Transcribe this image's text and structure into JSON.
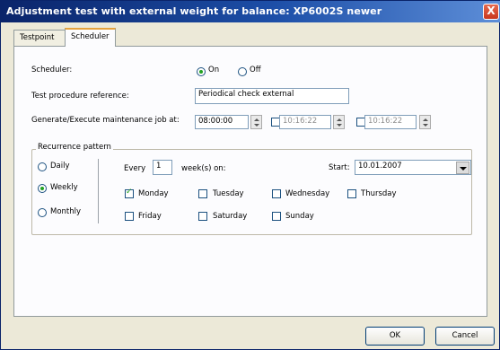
{
  "window": {
    "title": "Adjustment test with external weight for balance: XP6002S newer",
    "close_glyph": "X"
  },
  "tabs": [
    {
      "label": "Testpoint"
    },
    {
      "label": "Scheduler"
    }
  ],
  "scheduler": {
    "label": "Scheduler:",
    "options": [
      {
        "label": "On",
        "selected": true
      },
      {
        "label": "Off",
        "selected": false
      }
    ]
  },
  "procedure": {
    "label": "Test procedure reference:",
    "value": "Periodical check external"
  },
  "maintenance": {
    "label": "Generate/Execute maintenance job at:",
    "times": [
      {
        "value": "08:00:00",
        "enabled": true
      },
      {
        "value": "10:16:22",
        "enabled": false
      },
      {
        "value": "10:16:22",
        "enabled": false
      }
    ]
  },
  "recurrence": {
    "title": "Recurrence pattern",
    "patterns": [
      {
        "label": "Daily",
        "selected": false
      },
      {
        "label": "Weekly",
        "selected": true
      },
      {
        "label": "Monthly",
        "selected": false
      }
    ],
    "every_label": "Every",
    "every_value": "1",
    "weeks_label": "week(s) on:",
    "start_label": "Start:",
    "start_value": "10.01.2007",
    "days": [
      {
        "label": "Monday",
        "checked": true
      },
      {
        "label": "Tuesday",
        "checked": false
      },
      {
        "label": "Wednesday",
        "checked": false
      },
      {
        "label": "Thursday",
        "checked": false
      },
      {
        "label": "Friday",
        "checked": false
      },
      {
        "label": "Saturday",
        "checked": false
      },
      {
        "label": "Sunday",
        "checked": false
      }
    ]
  },
  "buttons": {
    "ok": "OK",
    "cancel": "Cancel"
  }
}
